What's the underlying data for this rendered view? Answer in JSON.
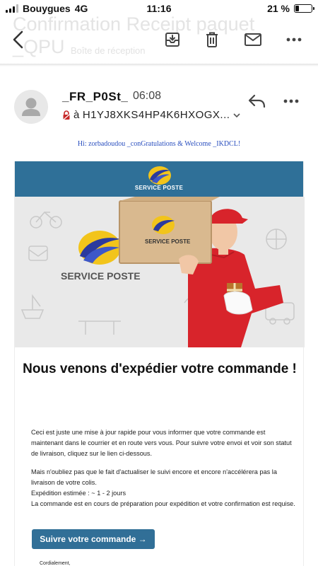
{
  "status_bar": {
    "carrier": "Bouygues",
    "network": "4G",
    "time": "11:16",
    "battery": "21 %",
    "battery_level": 0.21
  },
  "toolbar": {
    "background_title": "Confirmation Receipt paquet",
    "background_subtitle": "_QPU",
    "background_folder": "Boîte de réception",
    "icons": [
      "back-icon",
      "archive-icon",
      "trash-icon",
      "mail-icon",
      "more-icon"
    ]
  },
  "message": {
    "sender": "_FR_P0St_",
    "time": "06:08",
    "recipient_prefix": "à",
    "recipient": "H1YJ8XKS4HP4K6HXOGX...",
    "greeting": "Hi: zorbadoudou _conGratulations & Welcome _IKDCL!"
  },
  "email": {
    "brand": "SERVICE POSTE",
    "headline": "Nous venons d'expédier votre commande !",
    "paragraph1": "Ceci est juste une mise à jour rapide pour vous informer que votre commande est maintenant dans le courrier et en route vers vous. Pour suivre votre envoi et voir son statut de livraison, cliquez sur le lien ci-dessous.",
    "paragraph2_lines": [
      "Mais n'oubliez pas que le fait d'actualiser le suivi encore et encore n'accélérera pas la livraison de votre colis.",
      "Expédition estimée : ~ 1 - 2 jours",
      "La commande est en cours de préparation pour expédition et votre confirmation est requise."
    ],
    "cta_label": "Suivre votre commande →",
    "sign_off": "Cordialement,"
  },
  "colors": {
    "brand_blue": "#2f7098",
    "button_blue": "#316f97",
    "greeting_blue": "#2a4fbf",
    "courier_red": "#d8242b",
    "logo_yellow": "#f2c41b"
  }
}
